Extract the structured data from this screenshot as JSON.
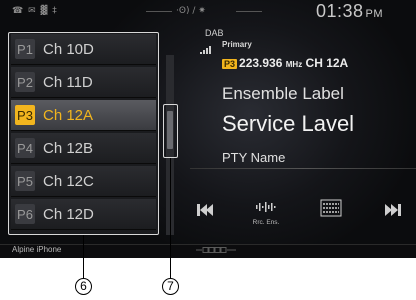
{
  "status": {
    "left_icons": "☎ ✉ ▓ ‡",
    "center_icons": "·ʘ) / ✷",
    "time": "01:38",
    "ampm": "PM"
  },
  "source": {
    "band": "DAB",
    "signal_icon": "signal-bars-icon",
    "service_type": "Primary"
  },
  "now_playing": {
    "preset_badge": "P3",
    "frequency": "223.936",
    "frequency_unit": "MHz",
    "channel": "CH 12A",
    "ensemble_label": "Ensemble Label",
    "service_label": "Service Lavel",
    "pty_name": "PTY Name"
  },
  "presets": [
    {
      "num": "P1",
      "channel": "Ch 10D",
      "active": false
    },
    {
      "num": "P2",
      "channel": "Ch 11D",
      "active": false
    },
    {
      "num": "P3",
      "channel": "Ch 12A",
      "active": true
    },
    {
      "num": "P4",
      "channel": "Ch 12B",
      "active": false
    },
    {
      "num": "P5",
      "channel": "Ch 12C",
      "active": false
    },
    {
      "num": "P6",
      "channel": "Ch 12D",
      "active": false
    }
  ],
  "controls": {
    "prev_icon": "skip-previous-icon",
    "rec_ens_label": "Rrc. Ens.",
    "list_icon": "ensemble-list-icon",
    "next_icon": "skip-next-icon"
  },
  "footer": {
    "device": "Alpine iPhone"
  },
  "callouts": {
    "preset_list": "6",
    "scrollbar": "7"
  },
  "colors": {
    "accent": "#f2b51e",
    "background": "#141519",
    "text": "#e8e8e8"
  }
}
